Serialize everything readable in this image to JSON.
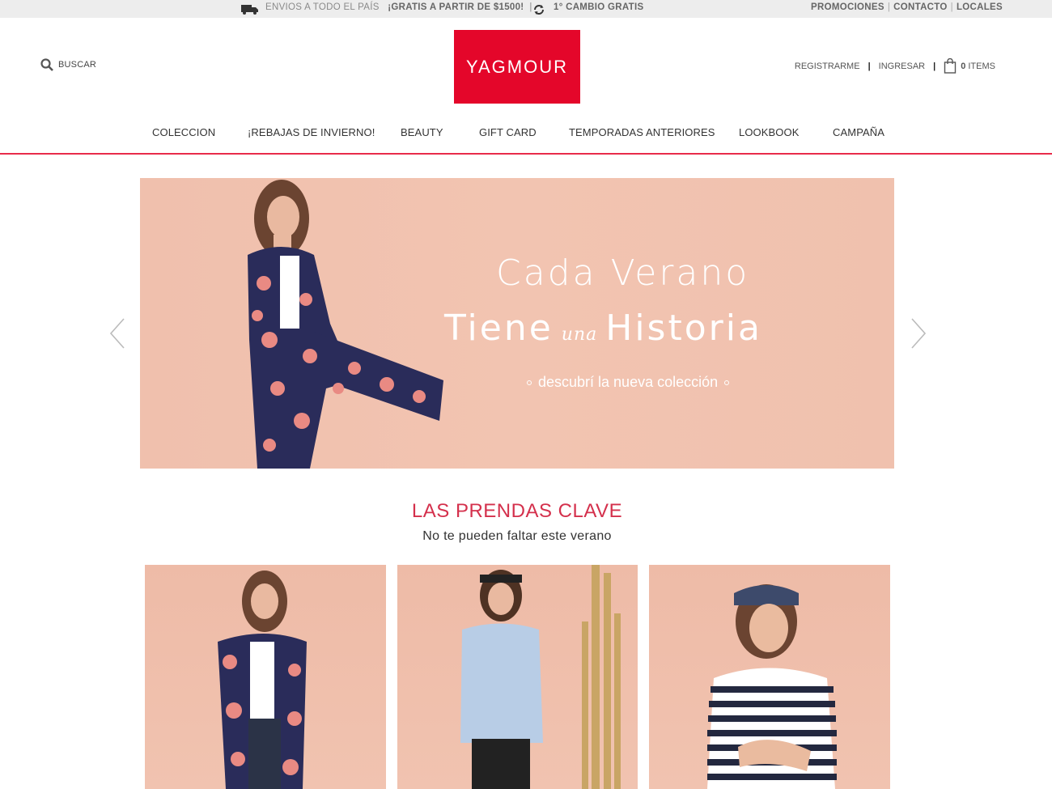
{
  "topbar": {
    "shipping_prefix": "ENVIOS A TODO EL PAÍS",
    "shipping_bold": "¡GRATIS A PARTIR DE $1500!",
    "exchange": "1° CAMBIO GRATIS",
    "links": [
      "PROMOCIONES",
      "CONTACTO",
      "LOCALES"
    ]
  },
  "header": {
    "search_label": "BUSCAR",
    "logo_text": "YAGMOUR",
    "register": "REGISTRARME",
    "login": "INGRESAR",
    "cart_count": "0",
    "cart_label": "ITEMS"
  },
  "nav": {
    "items": [
      "COLECCION",
      "¡REBAJAS DE INVIERNO!",
      "BEAUTY",
      "GIFT CARD",
      "TEMPORADAS ANTERIORES",
      "LOOKBOOK",
      "CAMPAÑA"
    ]
  },
  "hero": {
    "line1": "Cada Verano",
    "line2_a": "Tiene",
    "line2_una": "una",
    "line2_b": "Historia",
    "subtitle": "descubrí la nueva colección"
  },
  "section": {
    "title": "LAS PRENDAS CLAVE",
    "subtitle": "No te pueden faltar este verano"
  },
  "colors": {
    "brand_red": "#e4062a",
    "section_title": "#d4304c",
    "hero_bg": "#f1c3b0"
  },
  "icons": [
    "truck-icon",
    "refresh-icon",
    "search-icon",
    "shopping-bag-icon",
    "chevron-left-icon",
    "chevron-right-icon"
  ]
}
